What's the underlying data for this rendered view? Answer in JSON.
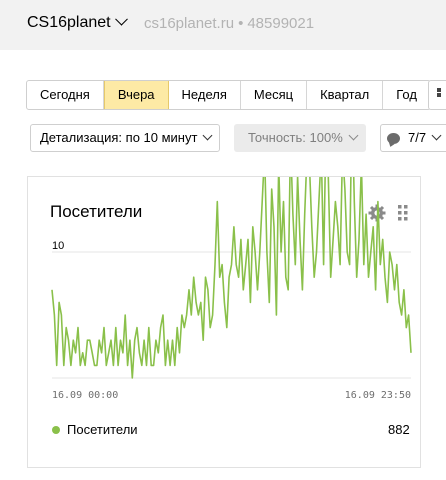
{
  "header": {
    "site_name": "CS16planet",
    "site_url": "cs16planet.ru",
    "separator": "•",
    "counter_id": "48599021"
  },
  "periods": [
    {
      "label": "Сегодня",
      "active": false
    },
    {
      "label": "Вчера",
      "active": true
    },
    {
      "label": "Неделя",
      "active": false
    },
    {
      "label": "Месяц",
      "active": false
    },
    {
      "label": "Квартал",
      "active": false
    },
    {
      "label": "Год",
      "active": false
    }
  ],
  "filters": {
    "detail_label": "Детализация: по 10 минут",
    "accuracy_label": "Точность: 100%",
    "segments_label": "7/7"
  },
  "widget": {
    "title": "Посетители",
    "legend_label": "Посетители",
    "total": "882"
  },
  "colors": {
    "series": "#8ac04a",
    "active_period": "#fdeaa5",
    "grid": "#e6e6e6"
  },
  "chart_data": {
    "type": "line",
    "title": "",
    "xlabel": "",
    "ylabel": "",
    "ylim": [
      0,
      22
    ],
    "yticks": [
      "10",
      "20"
    ],
    "xticks": [
      "16.09 00:00",
      "16.09 23:50"
    ],
    "series": [
      {
        "name": "Посетители",
        "values": [
          7,
          5,
          1,
          6,
          5,
          1,
          4,
          3,
          1,
          3,
          2,
          4,
          1,
          2,
          1,
          3,
          3,
          2,
          1,
          1,
          3,
          2,
          4,
          1,
          2,
          3,
          1,
          4,
          1,
          3,
          2,
          5,
          1,
          3,
          0,
          3,
          4,
          2,
          1,
          3,
          1,
          4,
          1,
          1,
          3,
          2,
          4,
          5,
          1,
          3,
          1,
          3,
          1,
          4,
          2,
          5,
          4,
          5,
          7,
          5,
          8,
          6,
          5,
          6,
          3,
          8,
          7,
          4,
          5,
          9,
          14,
          8,
          9,
          6,
          4,
          8,
          9,
          12,
          9,
          8,
          11,
          7,
          9,
          11,
          6,
          12,
          10,
          7,
          10,
          14,
          18,
          10,
          6,
          15,
          12,
          5,
          17,
          10,
          14,
          8,
          7,
          19,
          13,
          9,
          16,
          11,
          7,
          13,
          18,
          17,
          12,
          8,
          10,
          14,
          18,
          9,
          20,
          16,
          8,
          11,
          14,
          12,
          9,
          18,
          15,
          10,
          9,
          22,
          14,
          8,
          11,
          17,
          9,
          13,
          8,
          10,
          12,
          7,
          14,
          9,
          11,
          8,
          6,
          10,
          9,
          7,
          9,
          6,
          5,
          7,
          4,
          5,
          2
        ]
      }
    ]
  }
}
